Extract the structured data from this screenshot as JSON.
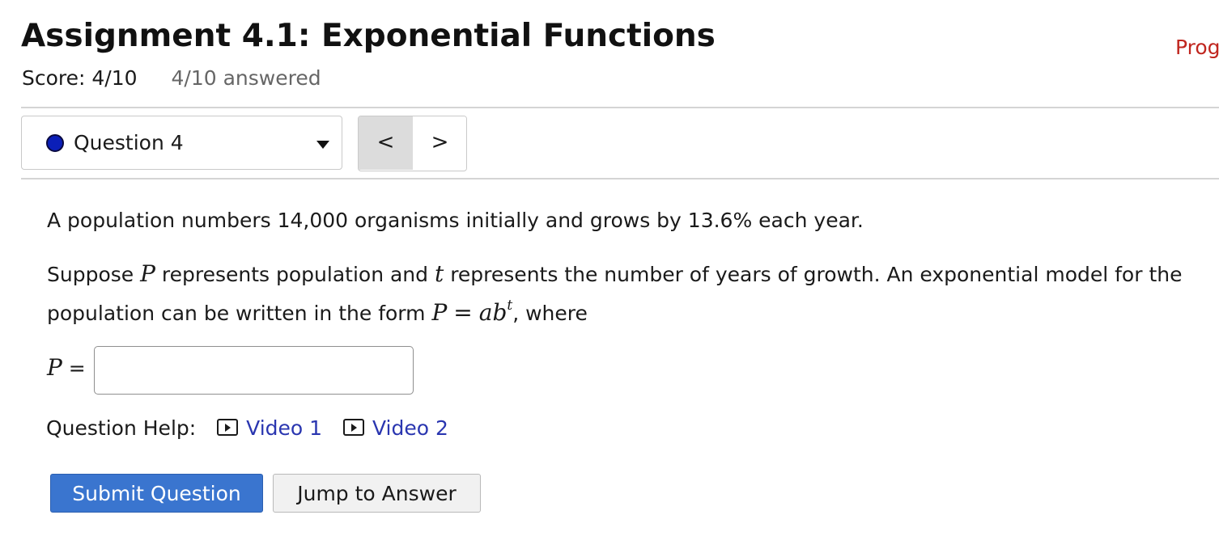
{
  "header": {
    "title": "Assignment 4.1: Exponential Functions",
    "progress_link": "Prog",
    "score": "Score: 4/10",
    "answered": "4/10 answered"
  },
  "question_nav": {
    "selected": "Question 4",
    "prev_label": "<",
    "next_label": ">"
  },
  "question": {
    "paragraph1": "A population numbers 14,000 organisms initially and grows by 13.6% each year.",
    "p2_before": "Suppose ",
    "var_P": "P",
    "p2_mid1": " represents population and ",
    "var_t": "t",
    "p2_mid2": " represents the number of years of growth. An exponential model for the population can be written in the form ",
    "eq_lhs": "P",
    "eq_sign": "=",
    "eq_rhs": "ab",
    "eq_exp": "t",
    "p2_after": ", where",
    "answer_label_var": "P",
    "answer_label_eq": " =",
    "answer_value": ""
  },
  "help": {
    "label": "Question Help:",
    "video1": "Video 1",
    "video2": "Video 2"
  },
  "actions": {
    "submit": "Submit Question",
    "jump": "Jump to Answer"
  },
  "colors": {
    "accent_blue": "#3a75cf",
    "progress_red": "#c0261f",
    "link_blue": "#2a36b0",
    "status_dot": "#0b1fb8"
  }
}
